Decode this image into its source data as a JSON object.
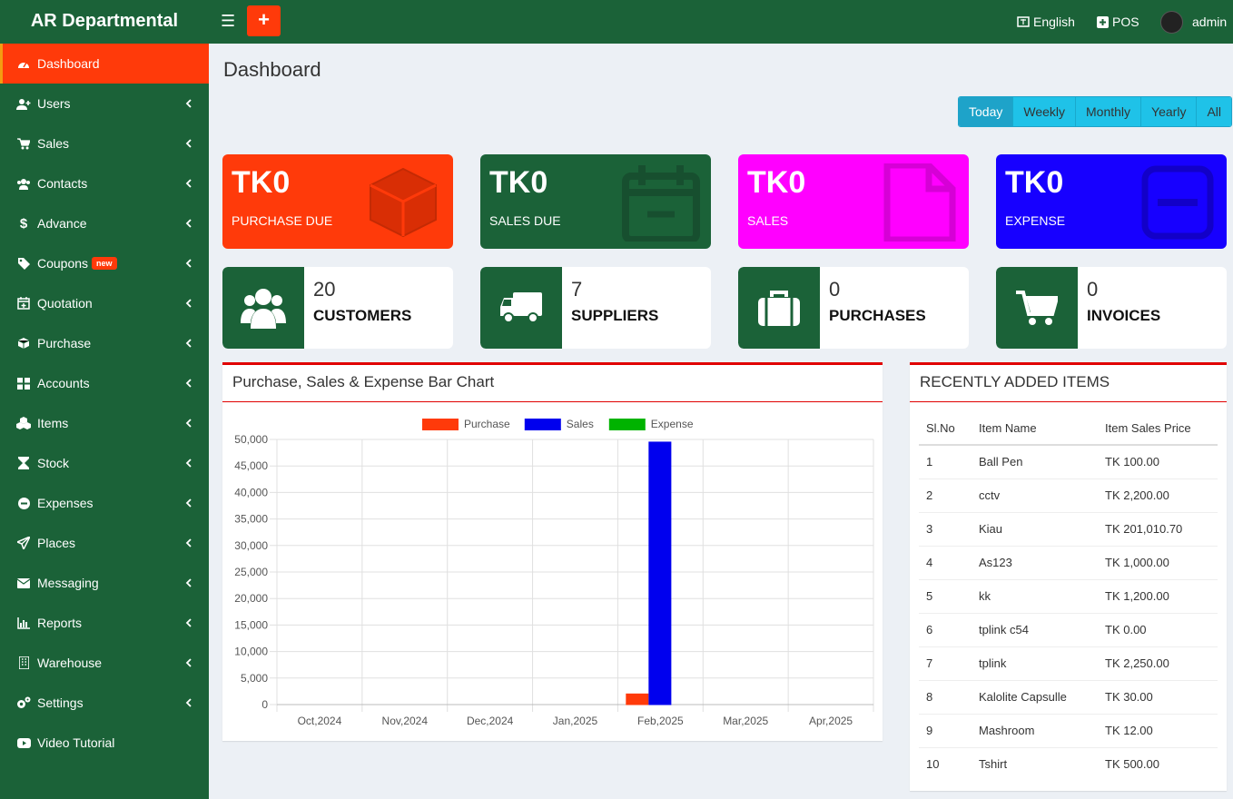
{
  "header": {
    "brand": "AR Departmental",
    "language": "English",
    "pos": "POS",
    "user": "admin"
  },
  "sidebar": {
    "items": [
      {
        "label": "Dashboard",
        "icon": "dashboard-icon"
      },
      {
        "label": "Users",
        "icon": "user-plus-icon"
      },
      {
        "label": "Sales",
        "icon": "cart-icon"
      },
      {
        "label": "Contacts",
        "icon": "users-icon"
      },
      {
        "label": "Advance",
        "icon": "dollar-icon"
      },
      {
        "label": "Coupons",
        "icon": "tags-icon",
        "badge": "new"
      },
      {
        "label": "Quotation",
        "icon": "calendar-plus-icon"
      },
      {
        "label": "Purchase",
        "icon": "cube-icon"
      },
      {
        "label": "Accounts",
        "icon": "grid-icon"
      },
      {
        "label": "Items",
        "icon": "cubes-icon"
      },
      {
        "label": "Stock",
        "icon": "hourglass-icon"
      },
      {
        "label": "Expenses",
        "icon": "minus-circle-icon"
      },
      {
        "label": "Places",
        "icon": "paper-plane-icon"
      },
      {
        "label": "Messaging",
        "icon": "envelope-icon"
      },
      {
        "label": "Reports",
        "icon": "bar-chart-icon"
      },
      {
        "label": "Warehouse",
        "icon": "building-icon"
      },
      {
        "label": "Settings",
        "icon": "gears-icon"
      },
      {
        "label": "Video Tutorial",
        "icon": "youtube-icon"
      }
    ]
  },
  "page": {
    "title": "Dashboard"
  },
  "period_tabs": [
    "Today",
    "Weekly",
    "Monthly",
    "Yearly",
    "All"
  ],
  "summary_boxes": [
    {
      "amount": "TK0",
      "label": "PURCHASE DUE",
      "color": "#ff3a0a",
      "icon": "cube-icon"
    },
    {
      "amount": "TK0",
      "label": "SALES DUE",
      "color": "#1b6238",
      "icon": "calendar-minus-icon"
    },
    {
      "amount": "TK0",
      "label": "SALES",
      "color": "#ff00ff",
      "icon": "file-icon"
    },
    {
      "amount": "TK0",
      "label": "EXPENSE",
      "color": "#1700ff",
      "icon": "minus-square-icon"
    }
  ],
  "info_boxes": [
    {
      "count": "20",
      "label": "CUSTOMERS",
      "icon": "users-icon"
    },
    {
      "count": "7",
      "label": "SUPPLIERS",
      "icon": "truck-icon"
    },
    {
      "count": "0",
      "label": "PURCHASES",
      "icon": "briefcase-icon"
    },
    {
      "count": "0",
      "label": "INVOICES",
      "icon": "cart-icon"
    }
  ],
  "chart_panel": {
    "title": "Purchase, Sales & Expense Bar Chart"
  },
  "chart_data": {
    "type": "bar",
    "categories": [
      "Oct,2024",
      "Nov,2024",
      "Dec,2024",
      "Jan,2025",
      "Feb,2025",
      "Mar,2025",
      "Apr,2025"
    ],
    "series": [
      {
        "name": "Purchase",
        "color": "#ff3a0a",
        "values": [
          0,
          0,
          0,
          0,
          2000,
          0,
          0
        ]
      },
      {
        "name": "Sales",
        "color": "#0000ee",
        "values": [
          0,
          0,
          0,
          0,
          49500,
          0,
          0
        ]
      },
      {
        "name": "Expense",
        "color": "#00b300",
        "values": [
          0,
          0,
          0,
          0,
          0,
          0,
          0
        ]
      }
    ],
    "ylim": [
      0,
      50000
    ],
    "yticks": [
      "50,000",
      "45,000",
      "40,000",
      "35,000",
      "30,000",
      "25,000",
      "20,000",
      "15,000",
      "10,000",
      "5,000",
      "0"
    ],
    "legend": "top",
    "grid": true
  },
  "recent_items": {
    "title": "RECENTLY ADDED ITEMS",
    "columns": [
      "Sl.No",
      "Item Name",
      "Item Sales Price"
    ],
    "rows": [
      [
        "1",
        "Ball Pen",
        "TK 100.00"
      ],
      [
        "2",
        "cctv",
        "TK 2,200.00"
      ],
      [
        "3",
        "Kiau",
        "TK 201,010.70"
      ],
      [
        "4",
        "As123",
        "TK 1,000.00"
      ],
      [
        "5",
        "kk",
        "TK 1,200.00"
      ],
      [
        "6",
        "tplink c54",
        "TK 0.00"
      ],
      [
        "7",
        "tplink",
        "TK 2,250.00"
      ],
      [
        "8",
        "Kalolite Capsulle",
        "TK 30.00"
      ],
      [
        "9",
        "Mashroom",
        "TK 12.00"
      ],
      [
        "10",
        "Tshirt",
        "TK 500.00"
      ]
    ]
  }
}
